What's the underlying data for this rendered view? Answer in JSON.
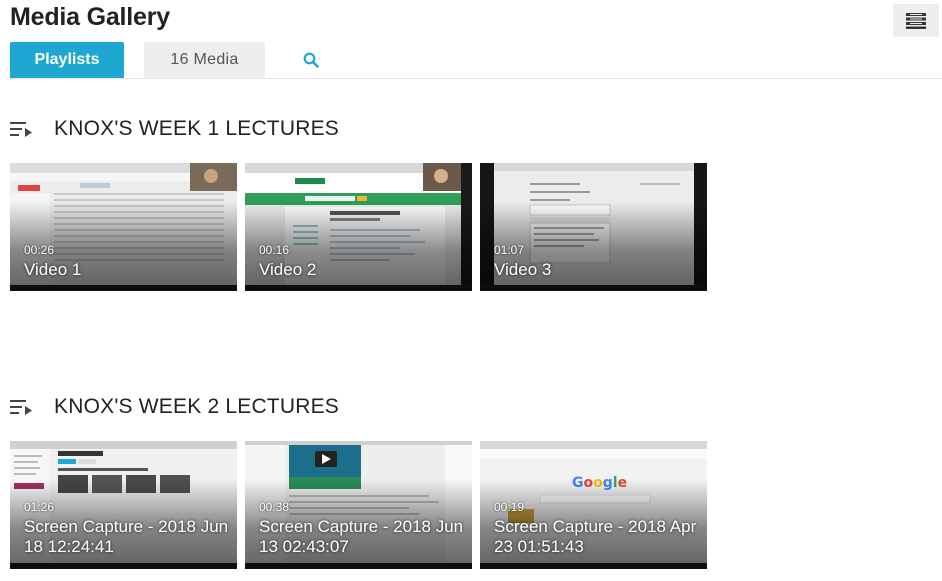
{
  "header": {
    "title": "Media Gallery",
    "menu_icon": "hamburger-list-icon"
  },
  "tabs": {
    "playlists_label": "Playlists",
    "media_label": "16 Media",
    "search_icon": "search-icon"
  },
  "colors": {
    "accent": "#1ea7d1",
    "tab_inactive_bg": "#eeeeee"
  },
  "playlists": [
    {
      "title": "KNOX'S WEEK 1 LECTURES",
      "icon": "playlist-icon",
      "videos": [
        {
          "duration": "00:26",
          "title": "Video 1"
        },
        {
          "duration": "00:16",
          "title": "Video 2"
        },
        {
          "duration": "01:07",
          "title": "Video 3"
        }
      ]
    },
    {
      "title": "KNOX'S WEEK 2 LECTURES",
      "icon": "playlist-icon",
      "videos": [
        {
          "duration": "01:26",
          "title": "Screen Capture - 2018 Jun 18 12:24:41"
        },
        {
          "duration": "00:38",
          "title": "Screen Capture - 2018 Jun 13 02:43:07"
        },
        {
          "duration": "00:19",
          "title": "Screen Capture - 2018 Apr 23 01:51:43"
        }
      ]
    }
  ]
}
